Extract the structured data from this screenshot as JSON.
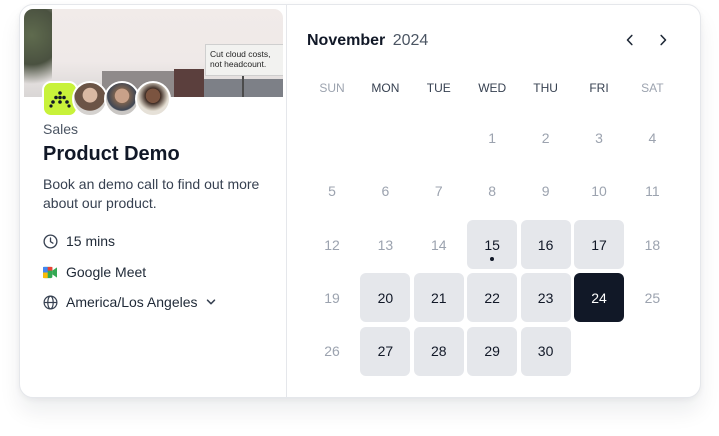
{
  "event": {
    "banner_text": "Cut cloud costs,\nnot headcount.",
    "category": "Sales",
    "title": "Product Demo",
    "description": "Book an demo call to find out more about our product.",
    "duration": "15 mins",
    "location": "Google Meet",
    "timezone": "America/Los Angeles"
  },
  "calendar": {
    "month": "November",
    "year": "2024",
    "weekdays": [
      "SUN",
      "MON",
      "TUE",
      "WED",
      "THU",
      "FRI",
      "SAT"
    ],
    "weeks": [
      [
        null,
        null,
        null,
        {
          "day": "1"
        },
        {
          "day": "2"
        },
        {
          "day": "3"
        },
        {
          "day": "4"
        }
      ],
      [
        {
          "day": "5"
        },
        {
          "day": "6"
        },
        {
          "day": "7"
        },
        {
          "day": "8"
        },
        {
          "day": "9"
        },
        {
          "day": "10"
        },
        {
          "day": "11"
        }
      ],
      [
        {
          "day": "12"
        },
        {
          "day": "13"
        },
        {
          "day": "14"
        },
        {
          "day": "15",
          "available": true,
          "today": true
        },
        {
          "day": "16",
          "available": true
        },
        {
          "day": "17",
          "available": true
        },
        {
          "day": "18"
        }
      ],
      [
        {
          "day": "19"
        },
        {
          "day": "20",
          "available": true
        },
        {
          "day": "21",
          "available": true
        },
        {
          "day": "22",
          "available": true
        },
        {
          "day": "23",
          "available": true
        },
        {
          "day": "24",
          "available": true,
          "selected": true
        },
        {
          "day": "25"
        }
      ],
      [
        {
          "day": "26"
        },
        {
          "day": "27",
          "available": true
        },
        {
          "day": "28",
          "available": true
        },
        {
          "day": "29",
          "available": true
        },
        {
          "day": "30",
          "available": true
        },
        null,
        null
      ]
    ]
  },
  "icons": {
    "prev": "chevron-left-icon",
    "next": "chevron-right-icon",
    "duration": "clock-icon",
    "location": "google-meet-icon",
    "timezone": "globe-icon",
    "timezone_toggle": "chevron-down-icon"
  },
  "colors": {
    "brand_logo": "#c8f23a",
    "available_day": "#e5e7eb",
    "selected_day": "#111827",
    "muted_text": "#9ca3af"
  }
}
